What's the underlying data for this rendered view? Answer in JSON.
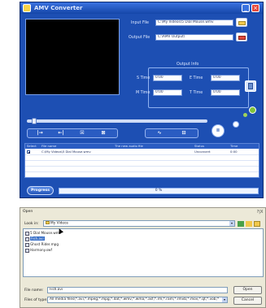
{
  "window": {
    "title": "AMV Converter",
    "minimize_glyph": "_",
    "close_glyph": "×",
    "title_icon": "app-icon"
  },
  "files": {
    "input_label": "Input File",
    "input_value": "C:\\My Videos\\5 Dial Mouse.wmv",
    "output_label": "Output File",
    "output_value": "C:\\AMV Output\\"
  },
  "output_info": {
    "title": "Output Info",
    "s_time_label": "S Time",
    "s_time_value": "0:00",
    "e_time_label": "E Time",
    "e_time_value": "0:00",
    "m_time_label": "M Time",
    "m_time_value": "0:00",
    "t_time_label": "T Time",
    "t_time_value": "0:00"
  },
  "toolbar": {
    "btn1": "|→",
    "btn2": "←|",
    "btn3": "☒",
    "btn4": "⊠",
    "btn5": "∿",
    "btn6": "⊟",
    "pause": "II"
  },
  "list": {
    "headers": [
      "Select",
      "File name",
      "The new audio file",
      "Status",
      "Time"
    ],
    "rows": [
      {
        "select": "☑",
        "file": "C:\\My Videos\\5 Dial Mouse.wmv",
        "audio": "",
        "status": "Unconvert",
        "time": "0:00"
      }
    ]
  },
  "progress": {
    "button_label": "Progress",
    "percent": 0,
    "percent_text": "0 %"
  },
  "dialog": {
    "title": "Open",
    "help": "?|X",
    "look_in_label": "Look in:",
    "look_in_value": "My Videos",
    "files": [
      {
        "name": "5 Dial Mouse.wmv",
        "selected": false
      },
      {
        "name": "Fish.avi",
        "selected": true
      },
      {
        "name": "Ghost Rider.mpg",
        "selected": false
      },
      {
        "name": "Harmony.swf",
        "selected": false
      }
    ],
    "file_name_label": "File name:",
    "file_name_value": "Fish.avi",
    "file_type_label": "Files of type:",
    "file_type_value": "All media files(*.avi;*.mpeg;*.mpg;*.dat;*.wmv;*.wma;*.asf;*.rm;*.ram;*.rmvb;*.mov;*.qt;*.vob;*",
    "open_button": "Open",
    "cancel_button": "Cancel"
  },
  "colors": {
    "window_bg": "#1d4fb3",
    "accent": "#2e63cc",
    "dialog_bg": "#ece9d8",
    "selection": "#316ac5"
  }
}
